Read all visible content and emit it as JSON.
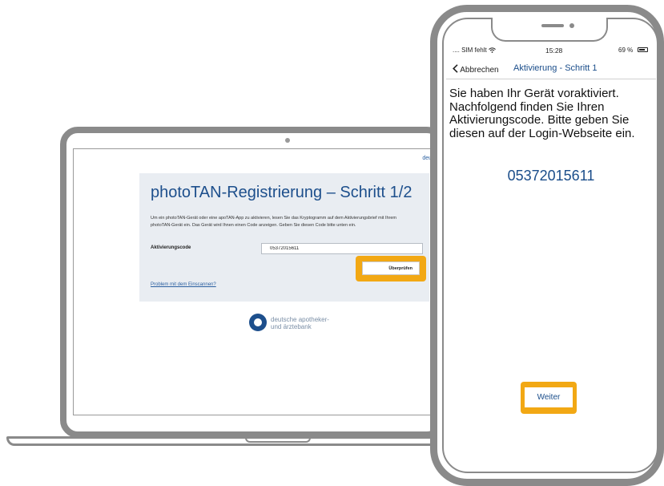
{
  "laptop": {
    "brand_stub": "deut",
    "registration": {
      "title": "photoTAN-Registrierung – Schritt 1/2",
      "description": "Um ein photoTAN-Gerät oder eine apoTAN-App zu aktivieren, lesen Sie das Kryptogramm auf dem Aktivierungsbrief mit Ihrem photoTAN-Gerät ein. Das Gerät wird Ihnen einen Code anzeigen. Geben Sie diesen Code bitte unten ein.",
      "code_label": "Aktivierungscode",
      "code_value": "05372015611",
      "check_button": "Überprüfen",
      "problem_link": "Problem mit dem Einscannen?"
    },
    "bank_name_line1": "deutsche apotheker-",
    "bank_name_line2": "und ärztebank"
  },
  "phone": {
    "status": {
      "carrier": ".... SIM fehlt",
      "time": "15:28",
      "battery": "69 %"
    },
    "nav": {
      "back_label": "Abbrechen",
      "title": "Aktivierung - Schritt 1"
    },
    "message": "Sie haben Ihr Gerät voraktiviert. Nachfolgend finden Sie Ihren Aktivierungscode. Bitte geben Sie diesen auf der Login-Webseite ein.",
    "activation_code": "05372015611",
    "next_button": "Weiter"
  },
  "colors": {
    "highlight": "#f2a814",
    "brand_blue": "#1d4f8c",
    "device_frame": "#8a8a8a"
  }
}
